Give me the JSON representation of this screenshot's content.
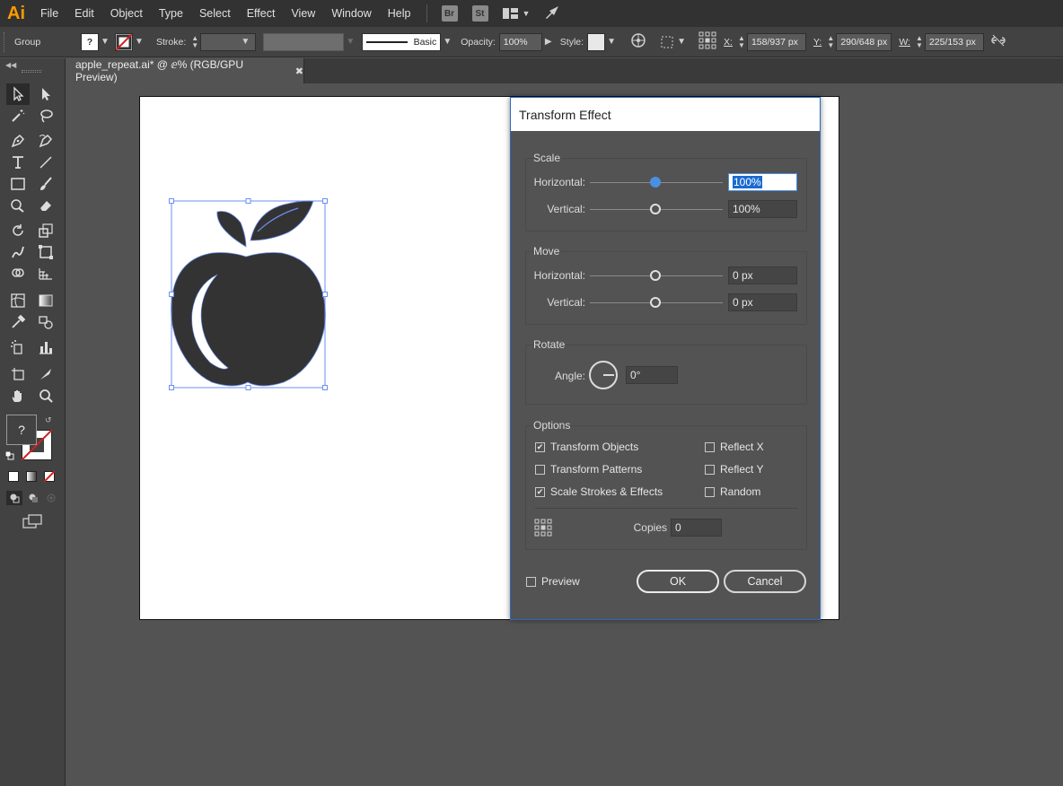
{
  "app": {
    "logo": "Ai"
  },
  "menu": [
    "File",
    "Edit",
    "Object",
    "Type",
    "Select",
    "Effect",
    "View",
    "Window",
    "Help"
  ],
  "menubar_badges": [
    "Br",
    "St"
  ],
  "control": {
    "selection": "Group",
    "fill_label": "?",
    "stroke_label": "Stroke:",
    "brush": "Basic",
    "opacity_label": "Opacity:",
    "opacity_value": "100%",
    "style_label": "Style:",
    "x_label": "X:",
    "x_value": "158/937 px",
    "y_label": "Y:",
    "y_value": "290/648 px",
    "w_label": "W:",
    "w_value": "225/153 px"
  },
  "document": {
    "tab_title": "apple_repeat.ai* @ ⅇ% (RGB/GPU Preview)",
    "close": "✖"
  },
  "tools": {
    "fill_unknown": "?"
  },
  "dialog": {
    "title": "Transform Effect",
    "scale": {
      "title": "Scale",
      "horizontal_label": "Horizontal:",
      "horizontal_value": "100%",
      "vertical_label": "Vertical:",
      "vertical_value": "100%"
    },
    "move": {
      "title": "Move",
      "horizontal_label": "Horizontal:",
      "horizontal_value": "0 px",
      "vertical_label": "Vertical:",
      "vertical_value": "0 px"
    },
    "rotate": {
      "title": "Rotate",
      "angle_label": "Angle:",
      "angle_value": "0°"
    },
    "options": {
      "title": "Options",
      "transform_objects": "Transform Objects",
      "transform_patterns": "Transform Patterns",
      "scale_strokes": "Scale Strokes & Effects",
      "reflect_x": "Reflect X",
      "reflect_y": "Reflect Y",
      "random": "Random",
      "copies_label": "Copies",
      "copies_value": "0"
    },
    "preview_label": "Preview",
    "ok": "OK",
    "cancel": "Cancel"
  }
}
